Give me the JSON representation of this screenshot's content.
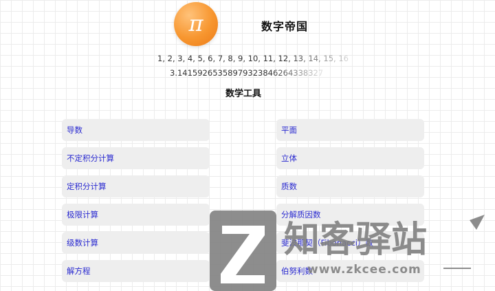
{
  "header": {
    "logo_icon": "pi-icon",
    "logo_symbol": "π",
    "title": "数字帝国"
  },
  "sequences": {
    "natural_numbers": "1, 2, 3, 4, 5, 6, 7, 8, 9, 10, 11, 12, 13, 14, 15, 16",
    "pi_digits": "3.14159265358979323846264338327"
  },
  "tools": {
    "section_title": "数学工具",
    "left": [
      {
        "label": "导数"
      },
      {
        "label": "不定积分计算"
      },
      {
        "label": "定积分计算"
      },
      {
        "label": "极限计算"
      },
      {
        "label": "级数计算"
      },
      {
        "label": "解方程"
      }
    ],
    "right": [
      {
        "label": "平面"
      },
      {
        "label": "立体"
      },
      {
        "label": "质数"
      },
      {
        "label": "分解质因数"
      },
      {
        "label": "斐波那契（Fibonacci）数"
      },
      {
        "label": "伯努利数"
      }
    ]
  },
  "watermark": {
    "logo_icon": "z-logo-icon",
    "name": "知客驿站",
    "url": "www.zkcee.com"
  },
  "colors": {
    "accent_orange": "#f7962f",
    "link_blue": "#2a2ad0",
    "tile_gray": "#eeeeee"
  }
}
